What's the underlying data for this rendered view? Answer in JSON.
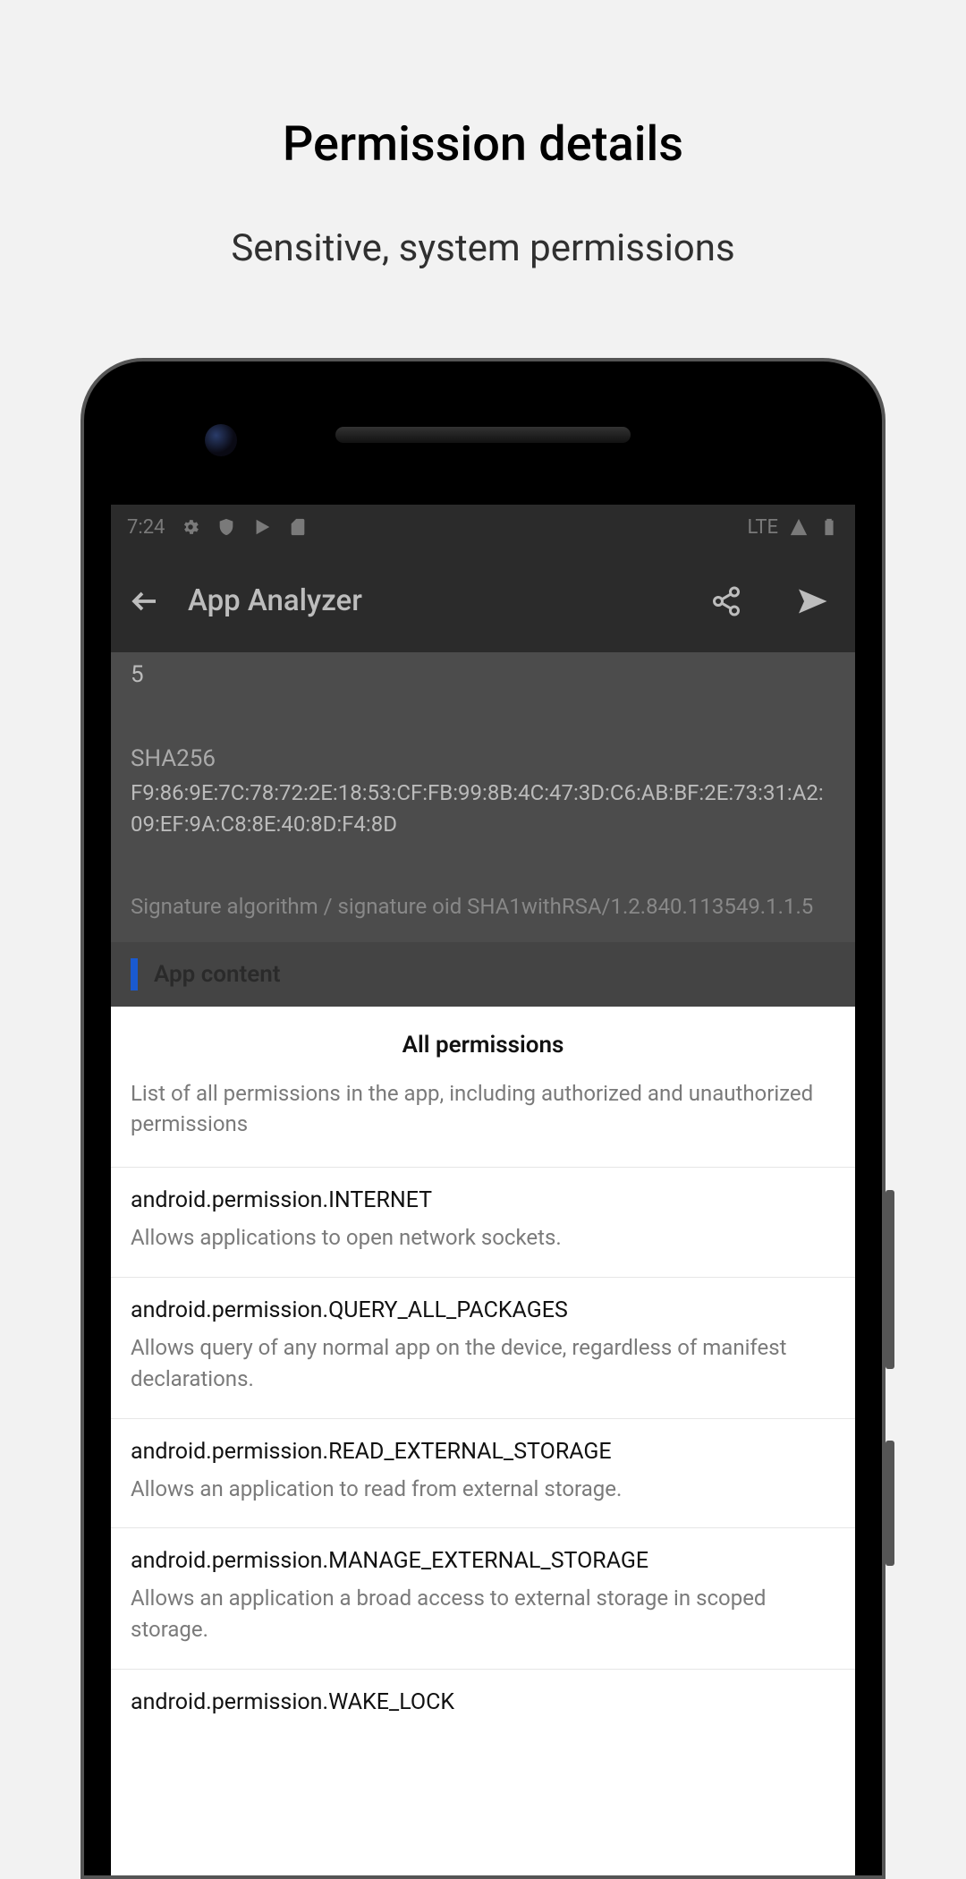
{
  "outer": {
    "title": "Permission details",
    "subtitle": "Sensitive, system permissions"
  },
  "status": {
    "time": "7:24",
    "network": "LTE"
  },
  "appbar": {
    "title": "App Analyzer"
  },
  "cert": {
    "num": "5",
    "sha_label": "SHA256",
    "sha_value": "F9:86:9E:7C:78:72:2E:18:53:CF:FB:99:8B:4C:47:3D:C6:AB:BF:2E:73:31:A2:09:EF:9A:C8:8E:40:8D:F4:8D",
    "sig_line": "Signature algorithm / signature oid  SHA1withRSA/1.2.840.113549.1.1.5"
  },
  "section": {
    "app_content": "App content"
  },
  "sheet": {
    "title": "All permissions",
    "subtitle": "List of all permissions in the app, including authorized and unauthorized permissions"
  },
  "permissions": [
    {
      "name": "android.permission.INTERNET",
      "desc": "Allows applications to open network sockets."
    },
    {
      "name": "android.permission.QUERY_ALL_PACKAGES",
      "desc": "Allows query of any normal app on the device, regardless of manifest declarations."
    },
    {
      "name": "android.permission.READ_EXTERNAL_STORAGE",
      "desc": "Allows an application to read from external storage."
    },
    {
      "name": "android.permission.MANAGE_EXTERNAL_STORAGE",
      "desc": "Allows an application a broad access to external storage in scoped storage."
    },
    {
      "name": "android.permission.WAKE_LOCK",
      "desc": ""
    }
  ]
}
